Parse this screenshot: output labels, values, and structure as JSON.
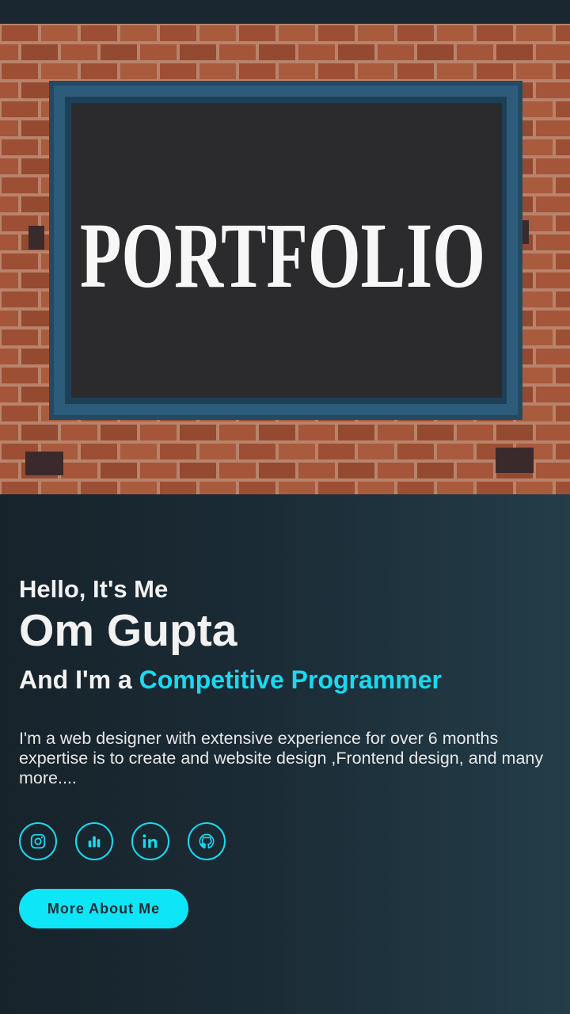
{
  "hero": {
    "sign_text": "PORTFOLIO"
  },
  "intro": {
    "greeting": "Hello, It's Me",
    "name": "Om Gupta",
    "role_prefix": "And I'm a ",
    "role": "Competitive Programmer",
    "bio": "I'm a web designer with extensive experience for over 6 months expertise is to create and website design ,Frontend design, and many more...."
  },
  "socials": [
    {
      "icon": "instagram-icon"
    },
    {
      "icon": "stats-icon"
    },
    {
      "icon": "linkedin-icon"
    },
    {
      "icon": "github-icon"
    }
  ],
  "cta": {
    "label": "More About Me"
  },
  "colors": {
    "accent": "#1ad9ef",
    "button": "#0ee6f8",
    "background": "#1a2730",
    "text": "#f2f2f2"
  }
}
